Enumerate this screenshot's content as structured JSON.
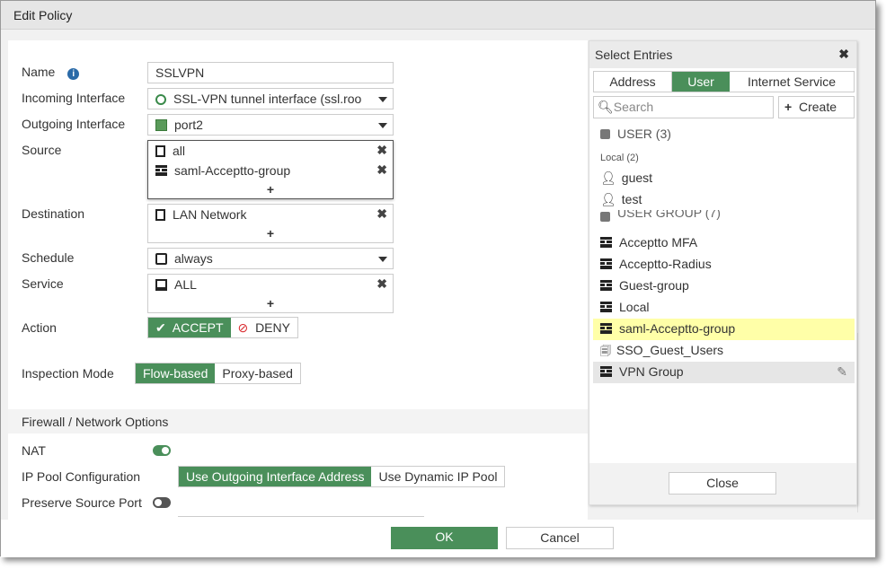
{
  "window": {
    "title": "Edit Policy"
  },
  "form": {
    "name": {
      "label": "Name",
      "value": "SSLVPN"
    },
    "incoming": {
      "label": "Incoming Interface",
      "value": "SSL-VPN tunnel interface (ssl.roo"
    },
    "outgoing": {
      "label": "Outgoing Interface",
      "value": "port2"
    },
    "source": {
      "label": "Source",
      "items": [
        "all",
        "saml-Acceptto-group"
      ]
    },
    "destination": {
      "label": "Destination",
      "items": [
        "LAN Network"
      ]
    },
    "schedule": {
      "label": "Schedule",
      "value": "always"
    },
    "service": {
      "label": "Service",
      "items": [
        "ALL"
      ]
    },
    "action": {
      "label": "Action",
      "accept": "ACCEPT",
      "deny": "DENY",
      "selected": "ACCEPT"
    },
    "inspection": {
      "label": "Inspection Mode",
      "flow": "Flow-based",
      "proxy": "Proxy-based",
      "selected": "Flow-based"
    },
    "section_title": "Firewall / Network Options",
    "nat": {
      "label": "NAT",
      "enabled": true
    },
    "ippool": {
      "label": "IP Pool Configuration",
      "outgoing": "Use Outgoing Interface Address",
      "dynamic": "Use Dynamic IP Pool",
      "selected": "Use Outgoing Interface Address"
    },
    "preserve": {
      "label": "Preserve Source Port",
      "enabled": false
    },
    "plus": "+"
  },
  "buttons": {
    "ok": "OK",
    "cancel": "Cancel"
  },
  "panel": {
    "title": "Select Entries",
    "tabs": [
      "Address",
      "User",
      "Internet Service"
    ],
    "active_tab": "User",
    "search_placeholder": "Search",
    "create": "Create",
    "user_header": "USER (3)",
    "local_header": "Local (2)",
    "users": [
      "guest",
      "test"
    ],
    "group_header": "USER GROUP (7)",
    "groups": [
      "Acceptto MFA",
      "Acceptto-Radius",
      "Guest-group",
      "Local",
      "saml-Acceptto-group",
      "SSO_Guest_Users",
      "VPN Group"
    ],
    "selected": "saml-Acceptto-group",
    "hovered": "VPN Group",
    "close": "Close"
  },
  "colors": {
    "accent": "#4a8f5a",
    "selected_row": "#ffffa8",
    "deny": "#d9262b"
  }
}
